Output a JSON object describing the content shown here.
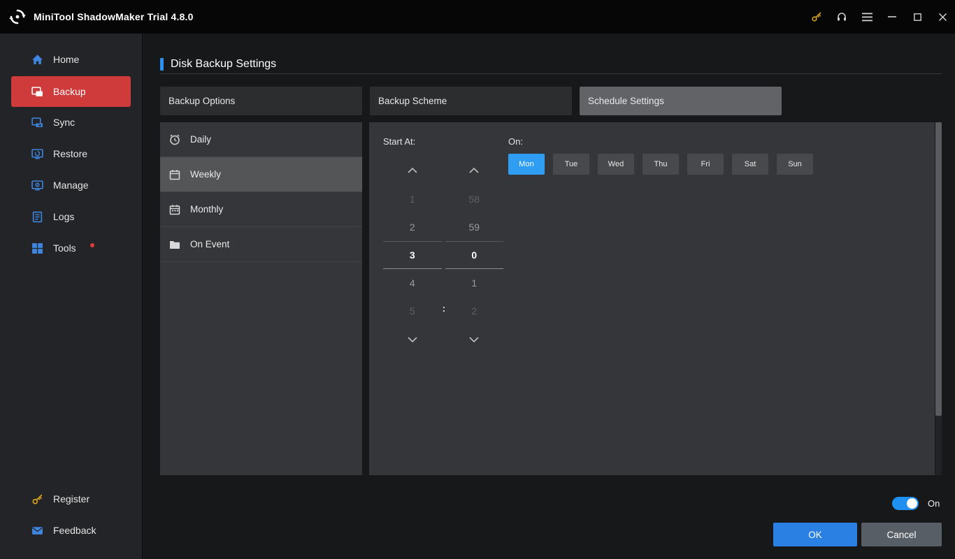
{
  "titlebar": {
    "app_title": "MiniTool ShadowMaker Trial 4.8.0"
  },
  "sidebar": {
    "items": [
      {
        "label": "Home"
      },
      {
        "label": "Backup"
      },
      {
        "label": "Sync"
      },
      {
        "label": "Restore"
      },
      {
        "label": "Manage"
      },
      {
        "label": "Logs"
      },
      {
        "label": "Tools"
      }
    ],
    "bottom_items": [
      {
        "label": "Register"
      },
      {
        "label": "Feedback"
      }
    ]
  },
  "main": {
    "page_title": "Disk Backup Settings",
    "tabs": [
      {
        "label": "Backup Options"
      },
      {
        "label": "Backup Scheme"
      },
      {
        "label": "Schedule Settings"
      }
    ],
    "schedule_list": [
      {
        "label": "Daily"
      },
      {
        "label": "Weekly"
      },
      {
        "label": "Monthly"
      },
      {
        "label": "On Event"
      }
    ],
    "start_at_label": "Start At:",
    "on_label": "On:",
    "colon": ":",
    "hours": [
      "1",
      "2",
      "3",
      "4",
      "5"
    ],
    "minutes": [
      "58",
      "59",
      "0",
      "1",
      "2"
    ],
    "selected_hour": "3",
    "selected_minute": "0",
    "days": [
      "Mon",
      "Tue",
      "Wed",
      "Thu",
      "Fri",
      "Sat",
      "Sun"
    ],
    "selected_day": "Mon",
    "toggle_state_label": "On",
    "ok_label": "OK",
    "cancel_label": "Cancel"
  },
  "colors": {
    "accent_blue": "#2e8ff2",
    "accent_red": "#cf3a3a",
    "day_selected_blue": "#2e9df2",
    "ok_blue": "#2b80e4",
    "toggle_blue": "#1f8ff0",
    "key_gold": "#d9a21b"
  }
}
